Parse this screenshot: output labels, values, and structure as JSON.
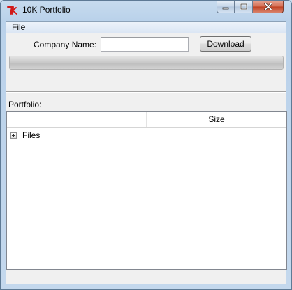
{
  "window": {
    "title": "10K Portfolio",
    "app_icon": "tk-feather-icon"
  },
  "menu": {
    "items": [
      {
        "label": "File"
      }
    ]
  },
  "form": {
    "company_label": "Company Name:",
    "company_value": "",
    "download_label": "Download"
  },
  "progress": {
    "value_percent": 100
  },
  "portfolio": {
    "label": "Portfolio:",
    "columns": [
      "",
      "Size"
    ],
    "rows": [
      {
        "label": "Files",
        "size": "",
        "expanded": false
      }
    ]
  },
  "status": {
    "text": ""
  },
  "colors": {
    "close_button": "#c7472a",
    "title_bar": "#b9d1ea"
  }
}
